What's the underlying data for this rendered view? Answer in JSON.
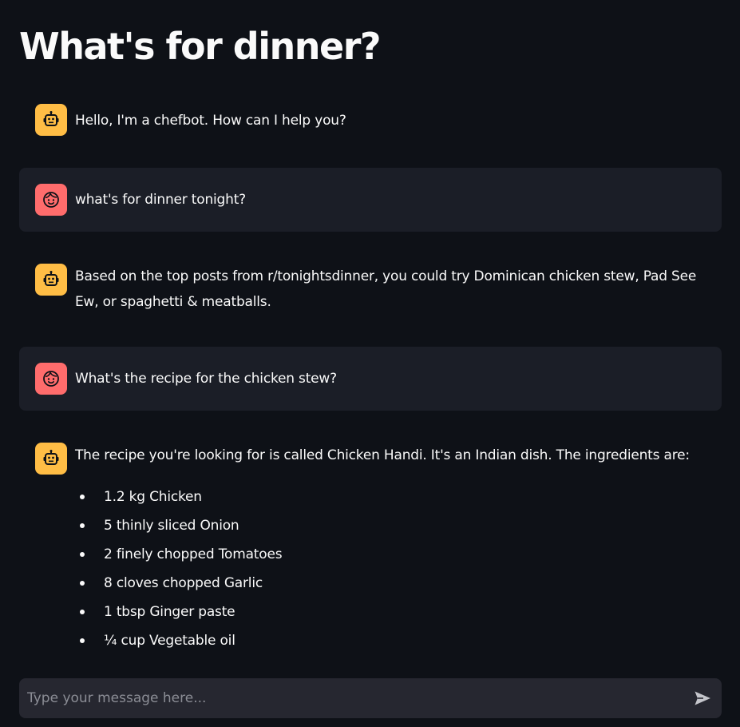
{
  "page": {
    "title": "What's for dinner?"
  },
  "messages": [
    {
      "role": "assistant",
      "avatar_icon": "robot-icon",
      "text": "Hello, I'm a chefbot. How can I help you?"
    },
    {
      "role": "user",
      "avatar_icon": "face-icon",
      "text": "what's for dinner tonight?"
    },
    {
      "role": "assistant",
      "avatar_icon": "robot-icon",
      "text": "Based on the top posts from r/tonightsdinner, you could try Dominican chicken stew, Pad See Ew, or spaghetti & meatballs."
    },
    {
      "role": "user",
      "avatar_icon": "face-icon",
      "text": "What's the recipe for the chicken stew?"
    },
    {
      "role": "assistant",
      "avatar_icon": "robot-icon",
      "text": "The recipe you're looking for is called Chicken Handi. It's an Indian dish. The ingredients are:",
      "list": [
        "1.2 kg Chicken",
        "5 thinly sliced Onion",
        "2 finely chopped Tomatoes",
        "8 cloves chopped Garlic",
        "1 tbsp Ginger paste",
        "¼ cup Vegetable oil"
      ]
    }
  ],
  "chat_input": {
    "placeholder": "Type your message here...",
    "value": "",
    "send_icon": "send-icon"
  },
  "colors": {
    "background": "#0e1117",
    "user_bubble": "#1b1e27",
    "bot_avatar": "#ffbd45",
    "user_avatar": "#ff6c6c",
    "input_background": "#262730",
    "text": "#fafafa"
  }
}
